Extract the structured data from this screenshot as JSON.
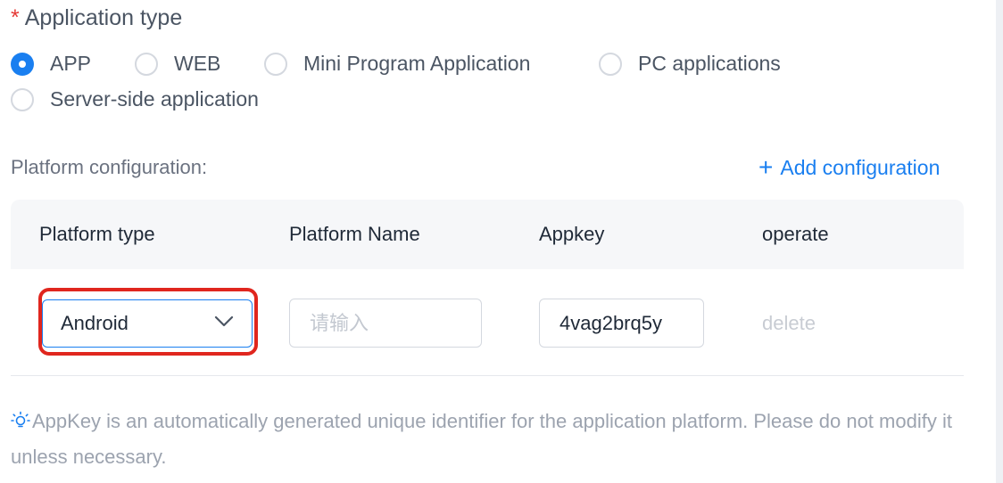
{
  "application_type": {
    "required_mark": "*",
    "label": "Application type",
    "options": [
      {
        "label": "APP",
        "checked": true
      },
      {
        "label": "WEB",
        "checked": false
      },
      {
        "label": "Mini Program Application",
        "checked": false
      },
      {
        "label": "PC applications",
        "checked": false
      },
      {
        "label": "Server-side application",
        "checked": false
      }
    ]
  },
  "platform_config": {
    "label": "Platform configuration:",
    "add_button": {
      "icon": "plus-icon",
      "label": "Add configuration"
    },
    "table": {
      "headers": [
        "Platform type",
        "Platform Name",
        "Appkey",
        "operate"
      ],
      "rows": [
        {
          "platform_type": "Android",
          "platform_name_value": "",
          "platform_name_placeholder": "请输入",
          "appkey": "4vag2brq5y",
          "operate": "delete"
        }
      ]
    },
    "tip": {
      "icon": "bulb-icon",
      "text": "AppKey is an automatically generated unique identifier for the application platform. Please do not modify it unless necessary."
    }
  },
  "colors": {
    "accent": "#1a7ff0",
    "required": "#e53935",
    "highlight": "#e0261e"
  }
}
